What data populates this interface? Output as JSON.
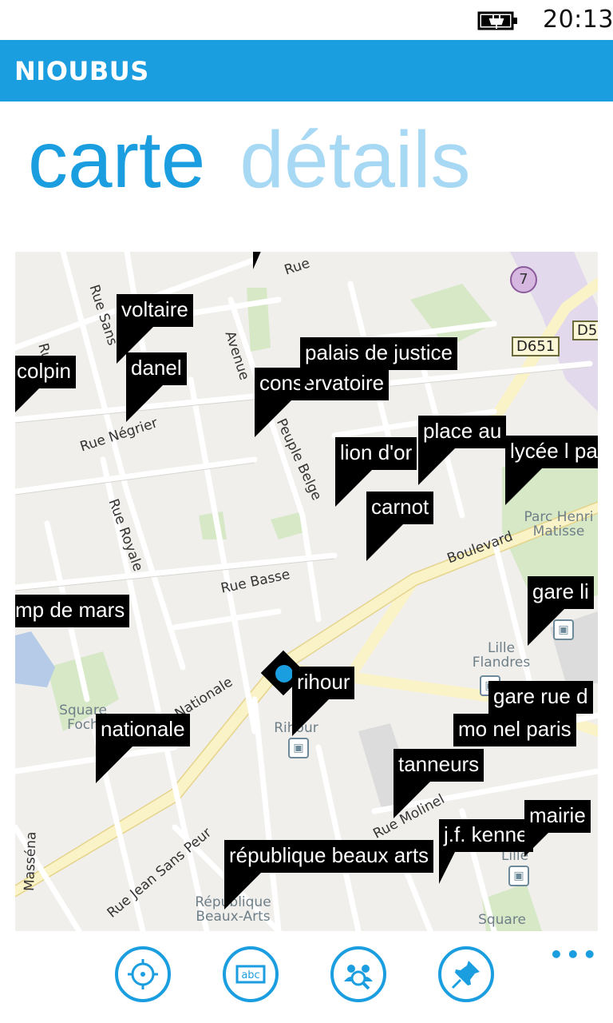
{
  "status": {
    "time": "20:13",
    "battery_icon": "battery-charging-icon"
  },
  "app": {
    "title": "NIOUBUS"
  },
  "pivot": {
    "tabs": [
      {
        "label": "carte"
      },
      {
        "label": "détails"
      }
    ]
  },
  "map": {
    "streets": [
      "Rue",
      "Rue Sans",
      "Rue",
      "Avenue",
      "Rue Négrier",
      "Rue Royale",
      "Rue Basse",
      "Boulevard",
      "Rue Nationale",
      "Peuple Belge",
      "Rue Jean Sans Peur",
      "Masséna",
      "Rue Molinel"
    ],
    "places": [
      "Parc Henri Matisse",
      "Lille Flandres",
      "Square Foch",
      "Rihour",
      "République Beaux-Arts",
      "Lille",
      "Square"
    ],
    "road_badges": [
      "D651",
      "D5"
    ],
    "route_number": "7",
    "stops": [
      {
        "label": "voltaire"
      },
      {
        "label": "colpin"
      },
      {
        "label": "danel"
      },
      {
        "label": "palais de justice"
      },
      {
        "label": "conservatoire"
      },
      {
        "label": "place au"
      },
      {
        "label": "lycée l pa"
      },
      {
        "label": "lion d'or"
      },
      {
        "label": "carnot"
      },
      {
        "label": "gare li"
      },
      {
        "label": "mp de mars"
      },
      {
        "label": "rihour"
      },
      {
        "label": "gare rue d"
      },
      {
        "label": "nationale"
      },
      {
        "label": "mo  nel paris"
      },
      {
        "label": "tanneurs"
      },
      {
        "label": "mairie"
      },
      {
        "label": "j.f. kenne"
      },
      {
        "label": "république beaux arts"
      }
    ]
  },
  "appbar": {
    "buttons": [
      {
        "icon": "locate-icon"
      },
      {
        "icon": "keyboard-abc-icon",
        "text": "abc"
      },
      {
        "icon": "people-search-icon"
      },
      {
        "icon": "pin-icon"
      }
    ],
    "more": "•••"
  }
}
